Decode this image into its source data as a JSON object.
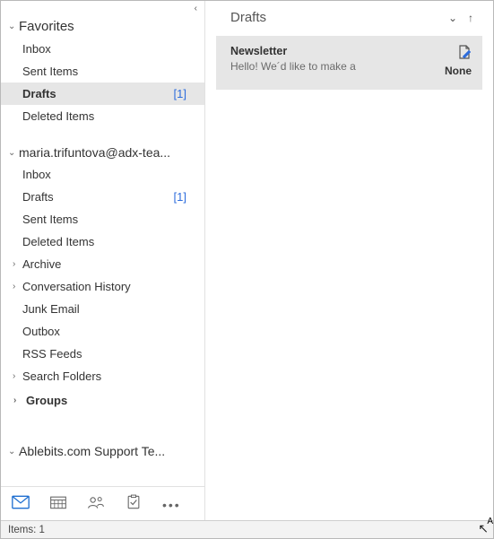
{
  "sections": {
    "favorites": {
      "title": "Favorites",
      "items": [
        {
          "label": "Inbox",
          "count": "",
          "bold": false,
          "selected": false,
          "hasCaret": false
        },
        {
          "label": "Sent Items",
          "count": "",
          "bold": false,
          "selected": false,
          "hasCaret": false
        },
        {
          "label": "Drafts",
          "count": "[1]",
          "bold": true,
          "selected": true,
          "hasCaret": false
        },
        {
          "label": "Deleted Items",
          "count": "",
          "bold": false,
          "selected": false,
          "hasCaret": false
        }
      ]
    },
    "account": {
      "title": "maria.trifuntova@adx-tea...",
      "items": [
        {
          "label": "Inbox",
          "count": "",
          "bold": false,
          "selected": false,
          "hasCaret": false
        },
        {
          "label": "Drafts",
          "count": "[1]",
          "bold": false,
          "selected": false,
          "hasCaret": false
        },
        {
          "label": "Sent Items",
          "count": "",
          "bold": false,
          "selected": false,
          "hasCaret": false
        },
        {
          "label": "Deleted Items",
          "count": "",
          "bold": false,
          "selected": false,
          "hasCaret": false
        },
        {
          "label": "Archive",
          "count": "",
          "bold": false,
          "selected": false,
          "hasCaret": true
        },
        {
          "label": "Conversation History",
          "count": "",
          "bold": false,
          "selected": false,
          "hasCaret": true
        },
        {
          "label": "Junk Email",
          "count": "",
          "bold": false,
          "selected": false,
          "hasCaret": false
        },
        {
          "label": "Outbox",
          "count": "",
          "bold": false,
          "selected": false,
          "hasCaret": false
        },
        {
          "label": "RSS Feeds",
          "count": "",
          "bold": false,
          "selected": false,
          "hasCaret": false
        },
        {
          "label": "Search Folders",
          "count": "",
          "bold": false,
          "selected": false,
          "hasCaret": true
        }
      ],
      "groups_label": "Groups"
    },
    "support": {
      "title": "Ablebits.com Support Te..."
    }
  },
  "reading": {
    "title": "Drafts",
    "message": {
      "subject": "Newsletter",
      "preview": "Hello!  We´d like to make a",
      "date": "None"
    }
  },
  "status": {
    "items_text": "Items: 1"
  }
}
